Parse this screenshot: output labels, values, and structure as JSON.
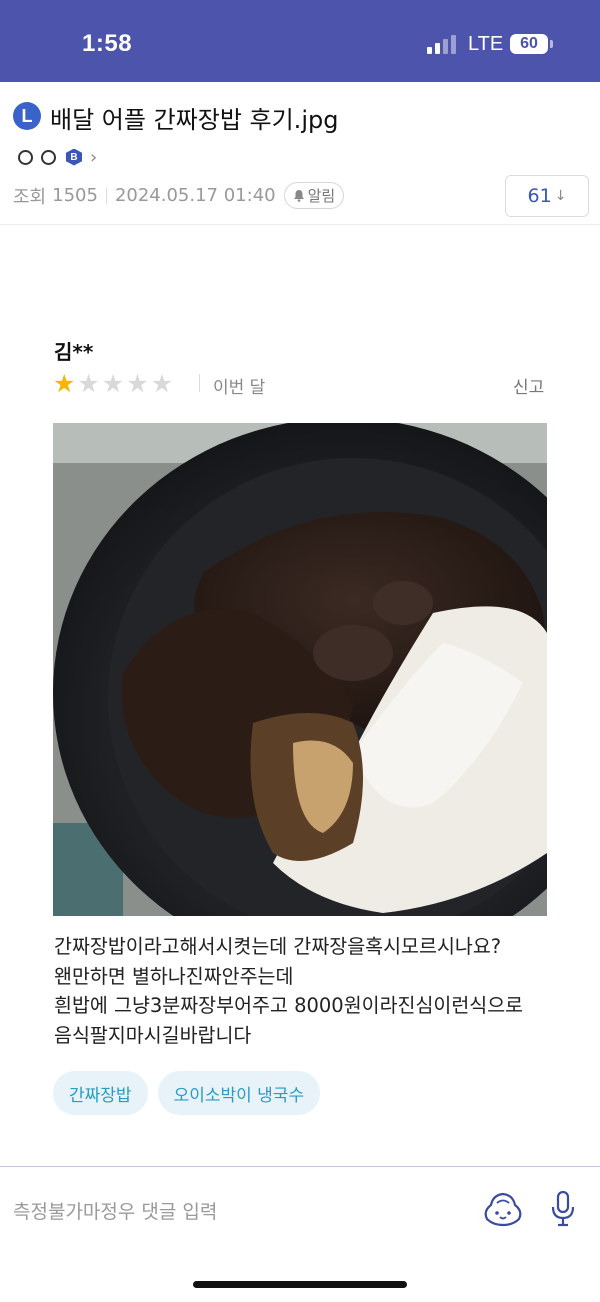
{
  "status_bar": {
    "time": "1:58",
    "network": "LTE",
    "battery": "60"
  },
  "post": {
    "board_logo": "L",
    "title": "배달 어플 간짜장밥 후기.jpg",
    "level_badge": "B",
    "views_label": "조회",
    "views": "1505",
    "datetime": "2024.05.17 01:40",
    "alarm_label": "알림",
    "comment_count": "61"
  },
  "review": {
    "author": "김**",
    "rating": 1,
    "max_rating": 5,
    "date": "이번 달",
    "report_label": "신고",
    "photo": "food-photo-jjajang-rice",
    "text_lines": [
      "간짜장밥이라고해서시켯는데 간짜장을혹시모르시나요?",
      "왠만하면 별하나진짜안주는데",
      "흰밥에 그냥3분짜장부어주고 8000원이라진심이런식으로",
      "음식팔지마시길바랍니다"
    ],
    "tags": [
      "간짜장밥",
      "오이소박이 냉국수"
    ]
  },
  "comment_bar": {
    "placeholder": "측정불가마정우 댓글 입력",
    "emoji_icon": "emoji-face-icon",
    "mic_icon": "mic-icon"
  },
  "colors": {
    "status_bar": "#4d54ab",
    "star_filled": "#f5b700",
    "star_empty": "#d9d9d9",
    "tag_bg": "#e7f3f8",
    "tag_text": "#2a9bc4"
  }
}
